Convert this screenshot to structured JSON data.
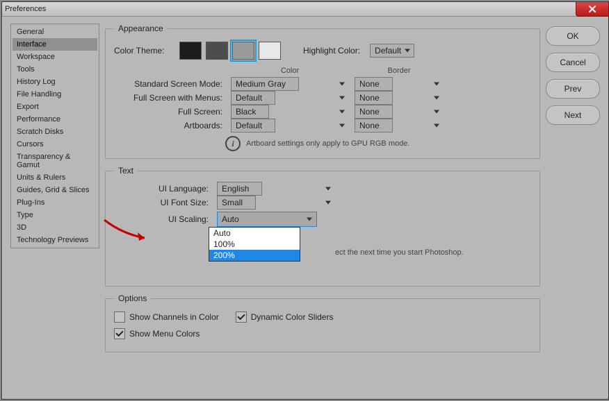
{
  "window": {
    "title": "Preferences"
  },
  "sidebar": {
    "items": [
      "General",
      "Interface",
      "Workspace",
      "Tools",
      "History Log",
      "File Handling",
      "Export",
      "Performance",
      "Scratch Disks",
      "Cursors",
      "Transparency & Gamut",
      "Units & Rulers",
      "Guides, Grid & Slices",
      "Plug-Ins",
      "Type",
      "3D",
      "Technology Previews"
    ],
    "selected_index": 1
  },
  "buttons": {
    "ok": "OK",
    "cancel": "Cancel",
    "prev": "Prev",
    "next": "Next"
  },
  "appearance": {
    "legend": "Appearance",
    "color_theme_label": "Color Theme:",
    "swatches": [
      "#1c1c1c",
      "#4d4d4d",
      "#9a9a9a",
      "#e8e8e8"
    ],
    "swatch_selected_index": 2,
    "highlight_label": "Highlight Color:",
    "highlight_value": "Default",
    "headers": {
      "color": "Color",
      "border": "Border"
    },
    "rows": [
      {
        "label": "Standard Screen Mode:",
        "color": "Medium Gray",
        "border": "None"
      },
      {
        "label": "Full Screen with Menus:",
        "color": "Default",
        "border": "None"
      },
      {
        "label": "Full Screen:",
        "color": "Black",
        "border": "None"
      },
      {
        "label": "Artboards:",
        "color": "Default",
        "border": "None"
      }
    ],
    "artboard_note": "Artboard settings only apply to GPU RGB mode."
  },
  "text": {
    "legend": "Text",
    "rows": {
      "ui_language": {
        "label": "UI Language:",
        "value": "English"
      },
      "ui_font_size": {
        "label": "UI Font Size:",
        "value": "Small"
      },
      "ui_scaling": {
        "label": "UI Scaling:",
        "value": "Auto"
      }
    },
    "scaling_options": [
      "Auto",
      "100%",
      "200%"
    ],
    "scaling_highlight_index": 2,
    "restart_note": "ect the next time you start Photoshop."
  },
  "options": {
    "legend": "Options",
    "channels": {
      "label": "Show Channels in Color",
      "checked": false
    },
    "dynamic": {
      "label": "Dynamic Color Sliders",
      "checked": true
    },
    "menu": {
      "label": "Show Menu Colors",
      "checked": true
    }
  }
}
